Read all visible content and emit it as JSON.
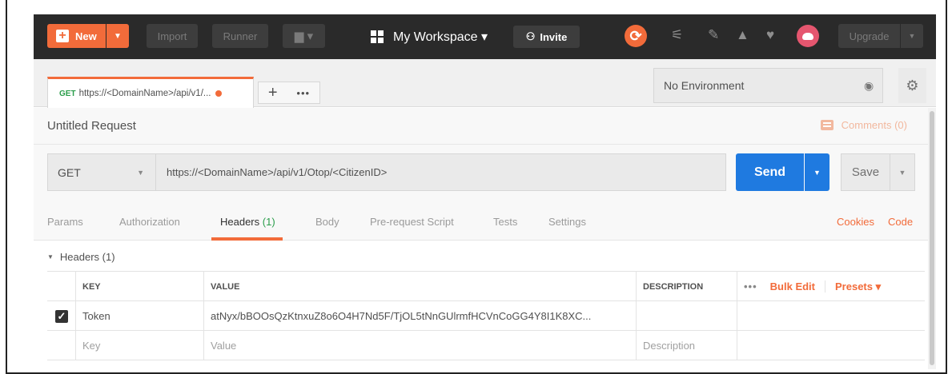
{
  "header": {
    "new_label": "New",
    "import_label": "Import",
    "runner_label": "Runner",
    "workspace_label": "My Workspace ▾",
    "invite_label": "Invite",
    "upgrade_label": "Upgrade"
  },
  "tabs": {
    "request_tab": {
      "method": "GET",
      "url": "https://<DomainName>/api/v1/..."
    },
    "add_label": "+",
    "more_label": "•••"
  },
  "environment": {
    "selected": "No Environment"
  },
  "request": {
    "title": "Untitled Request",
    "comments_label": "Comments (0)",
    "method": "GET",
    "url": "https://<DomainName>/api/v1/Otop/<CitizenID>",
    "send_label": "Send",
    "save_label": "Save"
  },
  "subtabs": {
    "params": "Params",
    "authorization": "Authorization",
    "headers": "Headers",
    "headers_count": "(1)",
    "body": "Body",
    "prerequest": "Pre-request Script",
    "tests": "Tests",
    "settings": "Settings",
    "cookies": "Cookies",
    "code": "Code"
  },
  "headers_section": {
    "toggle_label": "Headers (1)",
    "columns": {
      "key": "KEY",
      "value": "VALUE",
      "description": "DESCRIPTION"
    },
    "more_label": "•••",
    "bulk_edit": "Bulk Edit",
    "presets": "Presets ▾",
    "rows": [
      {
        "checked": true,
        "key": "Token",
        "value": "atNyx/bBOOsQzKtnxuZ8o6O4H7Nd5F/TjOL5tNnGUlrmfHCVnCoGG4Y8I1K8XC...",
        "description": ""
      }
    ],
    "placeholders": {
      "key": "Key",
      "value": "Value",
      "description": "Description"
    }
  },
  "colors": {
    "accent": "#f26b3a",
    "send": "#1f7ae0",
    "topbar": "#2a2a2a"
  }
}
